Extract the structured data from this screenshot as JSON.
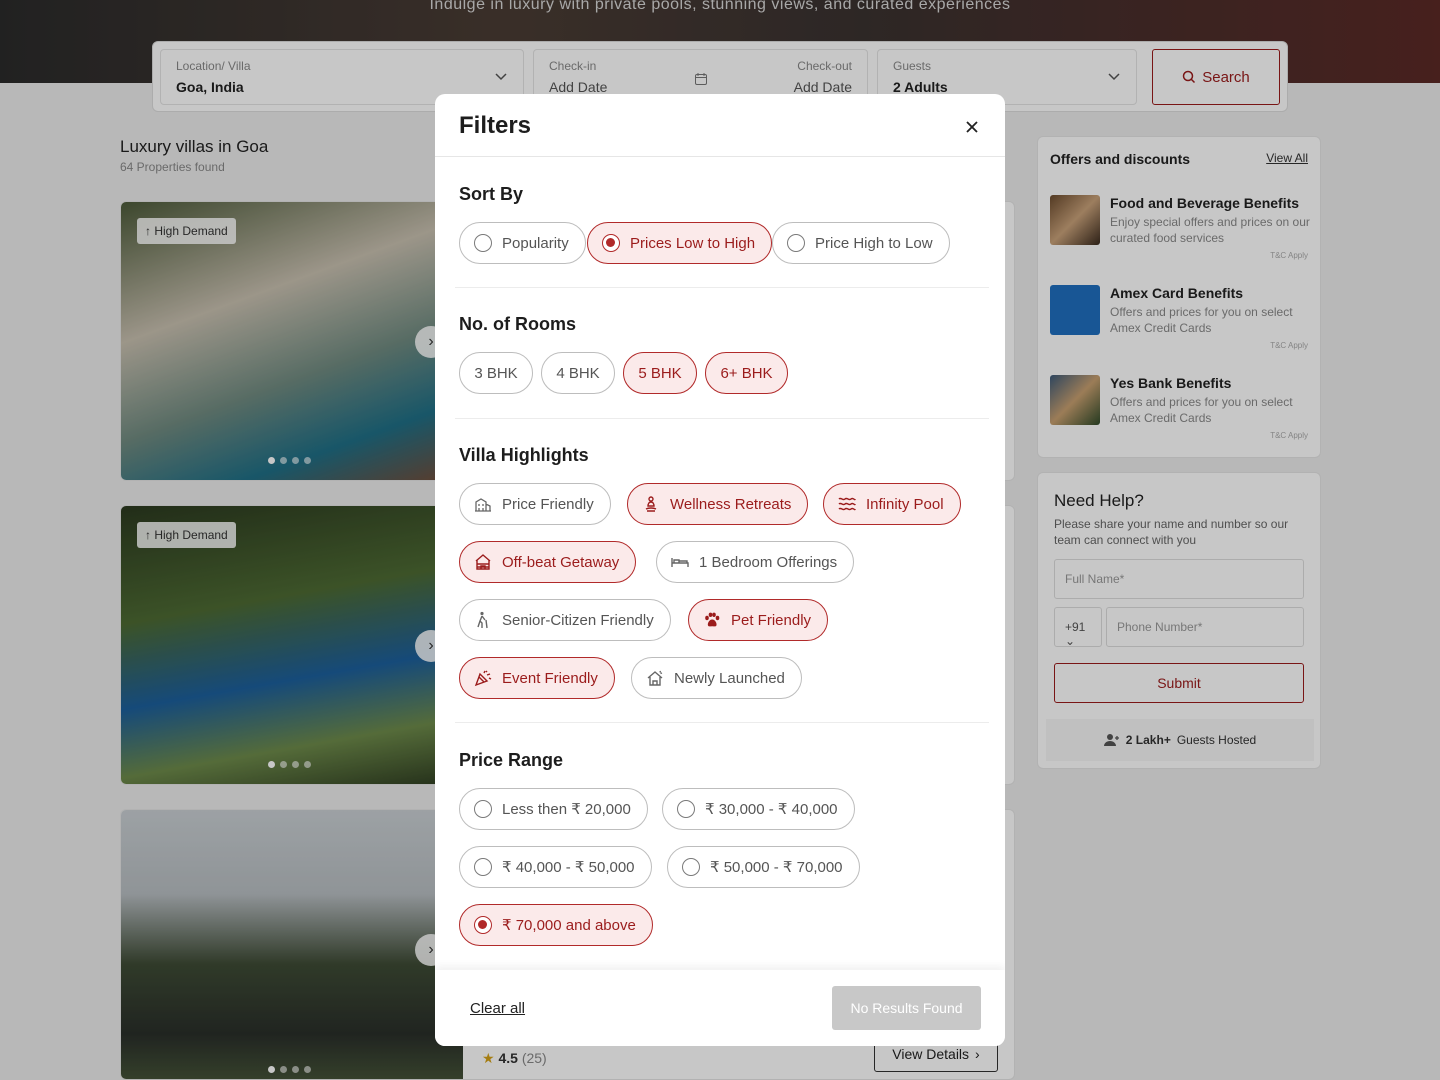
{
  "hero": {
    "tagline": "Indulge in luxury with private pools, stunning views, and curated experiences"
  },
  "search": {
    "location_label": "Location/ Villa",
    "location_value": "Goa, India",
    "checkin_label": "Check-in",
    "checkin_value": "Add Date",
    "checkout_label": "Check-out",
    "checkout_value": "Add Date",
    "guests_label": "Guests",
    "guests_value": "2 Adults",
    "search_label": "Search"
  },
  "listing": {
    "title": "Luxury villas in Goa",
    "count": "64 Properties found",
    "badge": "High Demand",
    "rating": "4.5",
    "reviews": "(25)",
    "view_details": "View Details"
  },
  "offers": {
    "title": "Offers and discounts",
    "view_all": "View All",
    "tc": "T&C Apply",
    "items": [
      {
        "name": "Food and Beverage Benefits",
        "desc": "Enjoy special offers and prices on our curated food services"
      },
      {
        "name": "Amex Card Benefits",
        "desc": "Offers and prices for you on select Amex Credit Cards"
      },
      {
        "name": "Yes Bank Benefits",
        "desc": "Offers and prices for you on select Amex Credit Cards"
      }
    ]
  },
  "help": {
    "title": "Need Help?",
    "desc": "Please share your name and number so our team can connect with you",
    "name_placeholder": "Full Name*",
    "country_code": "+91",
    "phone_placeholder": "Phone Number*",
    "submit": "Submit",
    "guests_hosted_bold": "2 Lakh+",
    "guests_hosted_rest": "Guests Hosted"
  },
  "filters": {
    "title": "Filters",
    "sort_by": {
      "title": "Sort By",
      "options": [
        "Popularity",
        "Prices Low to High",
        "Price High to Low"
      ],
      "selected": "Prices Low to High"
    },
    "rooms": {
      "title": "No. of Rooms",
      "options": [
        "3 BHK",
        "4 BHK",
        "5 BHK",
        "6+ BHK"
      ],
      "selected": [
        "5 BHK",
        "6+ BHK"
      ]
    },
    "highlights": {
      "title": "Villa Highlights",
      "options": [
        "Price Friendly",
        "Wellness Retreats",
        "Infinity Pool",
        "Off-beat Getaway",
        "1 Bedroom Offerings",
        "Senior-Citizen Friendly",
        "Pet Friendly",
        "Event Friendly",
        "Newly Launched"
      ],
      "selected": [
        "Wellness Retreats",
        "Infinity Pool",
        "Off-beat Getaway",
        "Pet Friendly",
        "Event Friendly"
      ]
    },
    "price": {
      "title": "Price Range",
      "options": [
        "Less then ₹ 20,000",
        "₹ 30,000 - ₹ 40,000",
        "₹ 40,000 - ₹ 50,000",
        "₹ 50,000 - ₹ 70,000",
        "₹ 70,000 and above"
      ],
      "selected": "₹ 70,000 and above"
    },
    "clear_all": "Clear all",
    "apply": "No Results Found"
  },
  "colors": {
    "accent": "#9b1c1c",
    "selected_bg": "#fbeaea"
  }
}
